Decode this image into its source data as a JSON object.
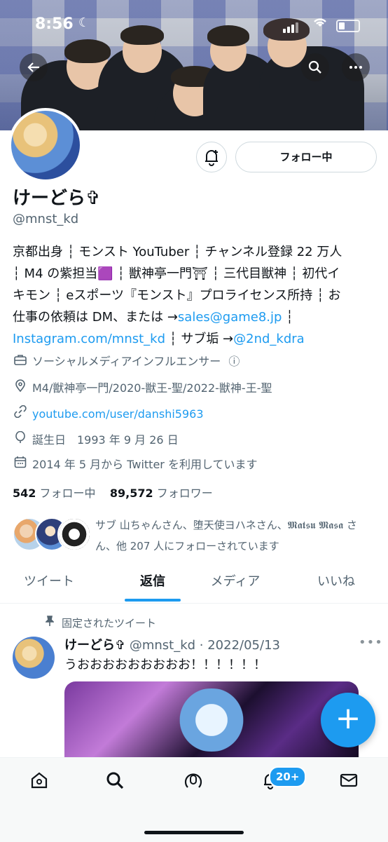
{
  "status": {
    "time": "8:56"
  },
  "header": {
    "back_icon": "back-arrow-icon",
    "search_icon": "search-icon",
    "more_icon": "more-icon"
  },
  "profile": {
    "name": "けーどら✞",
    "handle": "@mnst_kd",
    "follow_label": "フォロー中",
    "bio_lines": [
      "京都出身 ┆ モンスト YouTuber ┆ チャンネル登録 22 万人",
      "┆ M4 の紫担当🟪 ┆ 獣神亭一門⛩ ┆ 三代目獣神 ┆ 初代イ",
      "キモン ┆ eスポーツ『モンスト』プロライセンス所持 ┆ お",
      "仕事の依頼は DM、または →",
      "Instagram.com/mnst_kd",
      "┆ サブ垢 →"
    ],
    "email_link": "sales@game8.jp",
    "sub_link": "@2nd_kdra",
    "category": "ソーシャルメディアインフルエンサー",
    "location": "M4/獣神亭一門/2020-獣王-聖/2022-獣神-王-聖",
    "website": "youtube.com/user/danshi5963",
    "birthday": "誕生日　1993 年 9 月 26 日",
    "joined": "2014 年 5 月から Twitter を利用しています",
    "following_count": "542",
    "following_label": "フォロー中",
    "followers_count": "89,572",
    "followers_label": "フォロワー",
    "followed_by": "サブ 山ちゃんさん、堕天使ヨハネさん、𝕸𝖆𝖙𝖘𝖚 𝕸𝖆𝖘𝖆 さん、他 207 人にフォローされています"
  },
  "tabs": [
    "ツイート",
    "返信",
    "メディア",
    "いいね"
  ],
  "active_tab": "返信",
  "tweet": {
    "pinned_label": "固定されたツイート",
    "name": "けーどら✞",
    "handle_date": "@mnst_kd · 2022/05/13",
    "text": "うおおおおおおおおお！！！！！！"
  },
  "bottom_nav": {
    "items": [
      "home-icon",
      "search-icon",
      "spaces-icon",
      "notifications-icon",
      "messages-icon"
    ],
    "notification_badge": "20+"
  },
  "colors": {
    "accent": "#1d9bf0",
    "text": "#0f1419",
    "secondary": "#536471"
  }
}
